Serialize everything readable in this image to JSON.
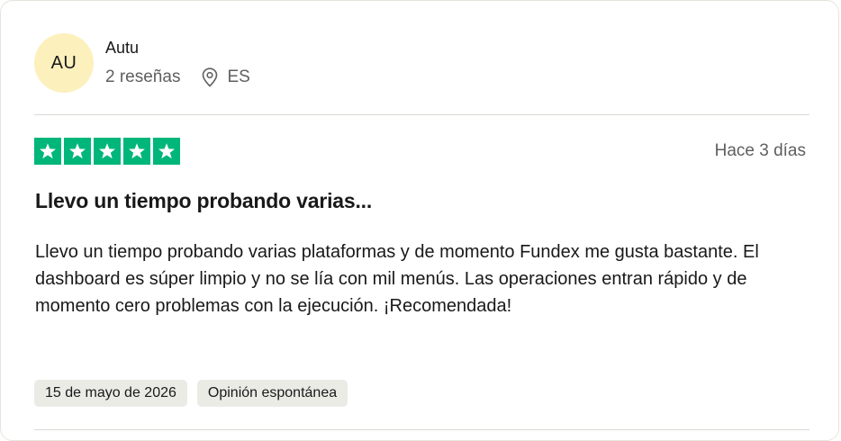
{
  "reviewer": {
    "initials": "AU",
    "name": "Autu",
    "reviews_count": "2 reseñas",
    "country": "ES"
  },
  "review": {
    "rating": 5,
    "date_ago": "Hace 3 días",
    "title": "Llevo un tiempo probando varias...",
    "body": "Llevo un tiempo probando varias plataformas y de momento Fundex me gusta bastante. El dashboard es súper limpio y no se lía con mil menús. Las operaciones entran rápido y de momento cero problemas con la ejecución. ¡Recomendada!",
    "experience_date": "15 de mayo de 2026",
    "tag": "Opinión espontánea"
  },
  "colors": {
    "star_green": "#00b67a",
    "avatar_bg": "#fcf0bd",
    "tag_bg": "#ebebe6"
  },
  "icons": {
    "location": "map-pin-icon",
    "star": "star-icon"
  }
}
